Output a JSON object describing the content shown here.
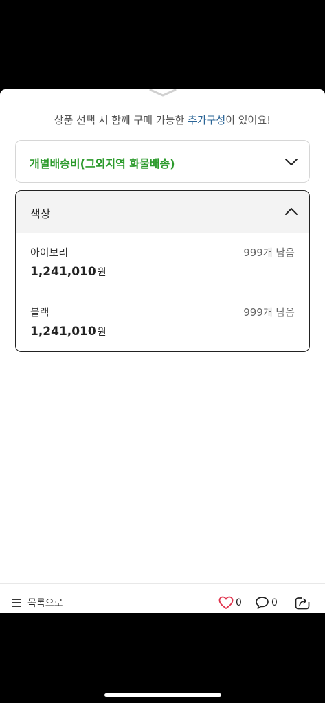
{
  "notice": {
    "prefix": "상품 선택 시 함께 구매 가능한 ",
    "accent": "추가구성",
    "suffix": "이 있어요!"
  },
  "shipping": {
    "label": "개별배송비(그외지역 화물배송)"
  },
  "color": {
    "title": "색상",
    "options": [
      {
        "name": "아이보리",
        "stock": "999개 남음",
        "price": "1,241,010",
        "unit": "원"
      },
      {
        "name": "블랙",
        "stock": "999개 남음",
        "price": "1,241,010",
        "unit": "원"
      }
    ]
  },
  "bottom": {
    "list_label": "목록으로",
    "like_count": "0",
    "comment_count": "0"
  },
  "colors": {
    "accent_blue": "#2a6496",
    "green": "#2b9a2b",
    "heart": "#e0314b"
  }
}
